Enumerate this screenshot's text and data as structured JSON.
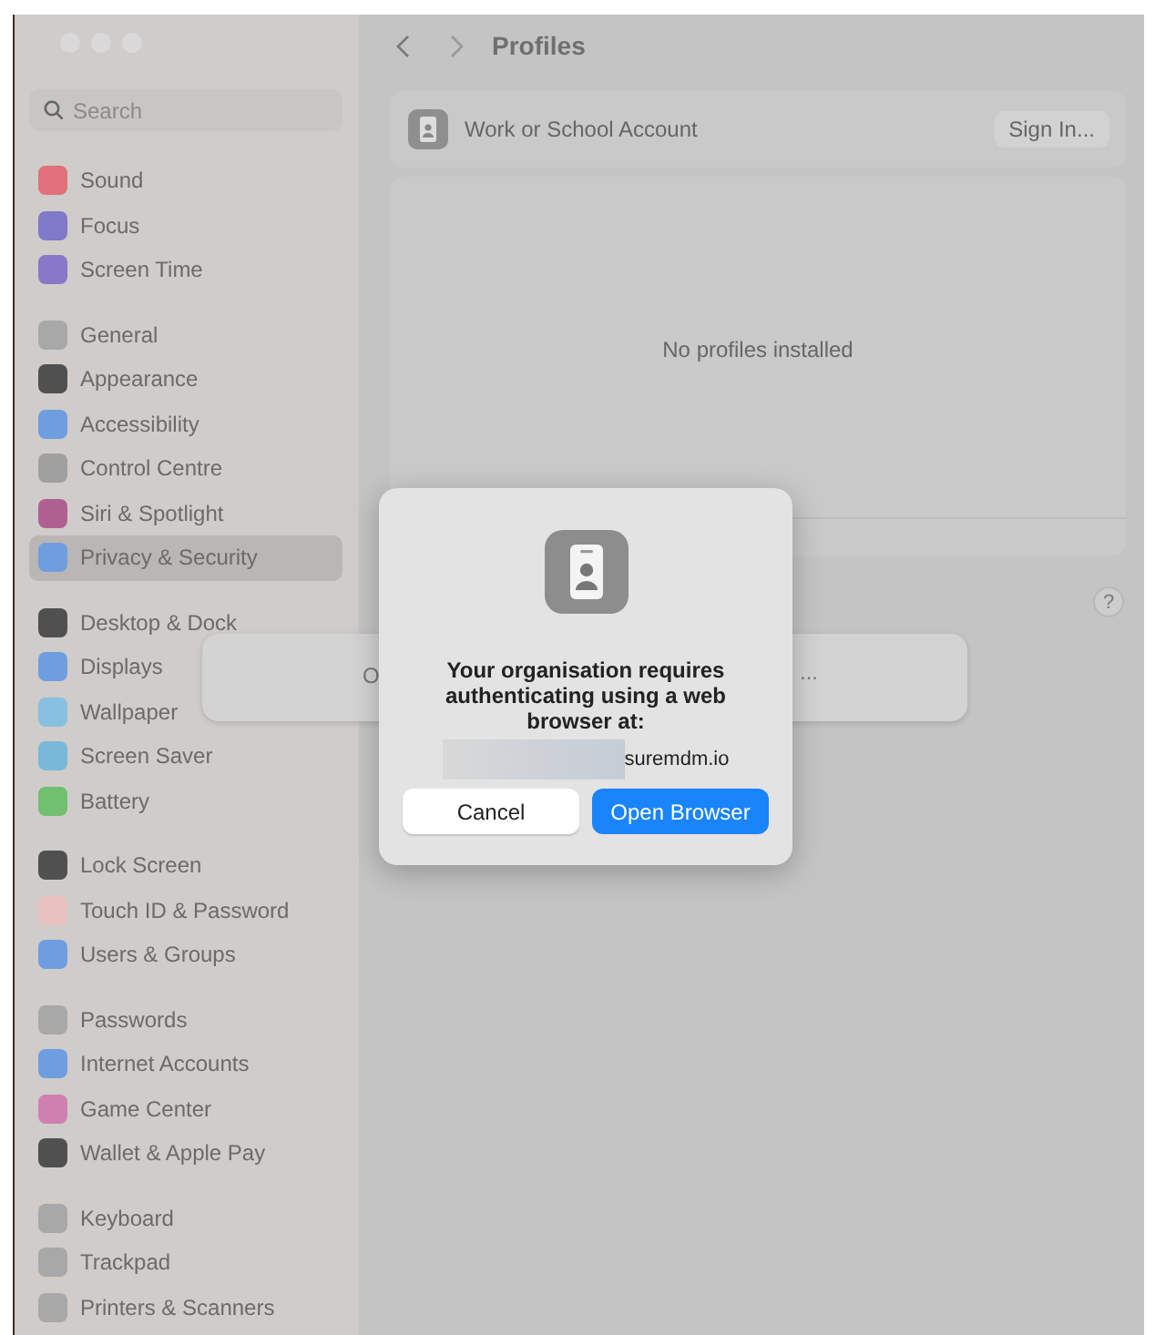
{
  "sidebar": {
    "search": {
      "placeholder": "Search"
    },
    "groups": [
      {
        "items": [
          {
            "label": "Sound",
            "color": "#e0707a",
            "selected": false
          },
          {
            "label": "Focus",
            "color": "#8078c8",
            "selected": false
          },
          {
            "label": "Screen Time",
            "color": "#8878c8",
            "selected": false
          }
        ]
      },
      {
        "items": [
          {
            "label": "General",
            "color": "#a8a8a8",
            "selected": false
          },
          {
            "label": "Appearance",
            "color": "#505050",
            "selected": false
          },
          {
            "label": "Accessibility",
            "color": "#6f9ee0",
            "selected": false
          },
          {
            "label": "Control Centre",
            "color": "#a0a0a0",
            "selected": false
          },
          {
            "label": "Siri & Spotlight",
            "color": "#b06090",
            "selected": false
          },
          {
            "label": "Privacy & Security",
            "color": "#6f9ee0",
            "selected": true
          }
        ]
      },
      {
        "items": [
          {
            "label": "Desktop & Dock",
            "color": "#505050",
            "selected": false
          },
          {
            "label": "Displays",
            "color": "#6f9ee0",
            "selected": false
          },
          {
            "label": "Wallpaper",
            "color": "#88c0e0",
            "selected": false
          },
          {
            "label": "Screen Saver",
            "color": "#78b8d8",
            "selected": false
          },
          {
            "label": "Battery",
            "color": "#70c070",
            "selected": false
          }
        ]
      },
      {
        "items": [
          {
            "label": "Lock Screen",
            "color": "#505050",
            "selected": false
          },
          {
            "label": "Touch ID & Password",
            "color": "#e8c0c0",
            "selected": false
          },
          {
            "label": "Users & Groups",
            "color": "#6f9ee0",
            "selected": false
          }
        ]
      },
      {
        "items": [
          {
            "label": "Passwords",
            "color": "#a8a8a8",
            "selected": false
          },
          {
            "label": "Internet Accounts",
            "color": "#6f9ee0",
            "selected": false
          },
          {
            "label": "Game Center",
            "color": "#d080b0",
            "selected": false
          },
          {
            "label": "Wallet & Apple Pay",
            "color": "#505050",
            "selected": false
          }
        ]
      },
      {
        "items": [
          {
            "label": "Keyboard",
            "color": "#a8a8a8",
            "selected": false
          },
          {
            "label": "Trackpad",
            "color": "#a8a8a8",
            "selected": false
          },
          {
            "label": "Printers & Scanners",
            "color": "#a8a8a8",
            "selected": false
          }
        ]
      }
    ]
  },
  "toolbar": {
    "title": "Profiles"
  },
  "account": {
    "label": "Work or School Account",
    "button": "Sign In..."
  },
  "profiles": {
    "empty_text": "No profiles installed"
  },
  "help": "?",
  "sheet": {
    "text_start": "O",
    "text_end": "..."
  },
  "dialog": {
    "message": "Your organisation requires authenticating using a web browser at:",
    "url": "suremdm.io",
    "buttons": [
      {
        "label": "Cancel",
        "kind": "secondary"
      },
      {
        "label": "Open Browser",
        "kind": "primary"
      }
    ]
  }
}
